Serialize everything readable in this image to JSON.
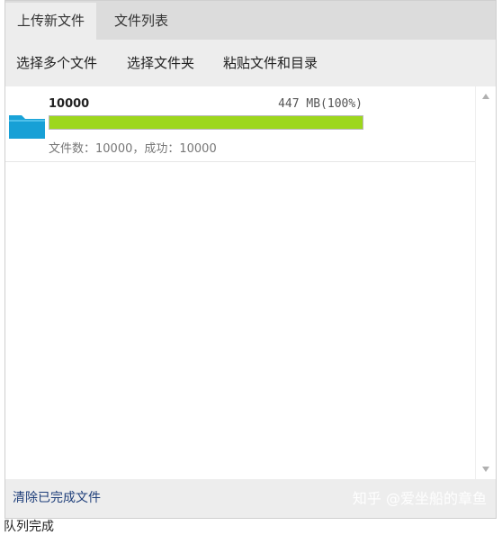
{
  "tabs": [
    {
      "label": "上传新文件",
      "active": true
    },
    {
      "label": "文件列表",
      "active": false
    }
  ],
  "toolbar": {
    "select_files": "选择多个文件",
    "select_folder": "选择文件夹",
    "paste": "粘贴文件和目录"
  },
  "queue": {
    "items": [
      {
        "name": "10000",
        "size": "447 MB(100%)",
        "progress_percent": 100,
        "stats": "文件数：10000，成功：10000",
        "icon": "folder-icon"
      }
    ]
  },
  "footer": {
    "clear_completed": "清除已完成文件",
    "watermark": "知乎 @爱坐船的章鱼"
  },
  "status": "队列完成",
  "colors": {
    "progress_fill": "#9dd71c",
    "folder": "#1aa3d8",
    "link": "#1f3f7a"
  }
}
